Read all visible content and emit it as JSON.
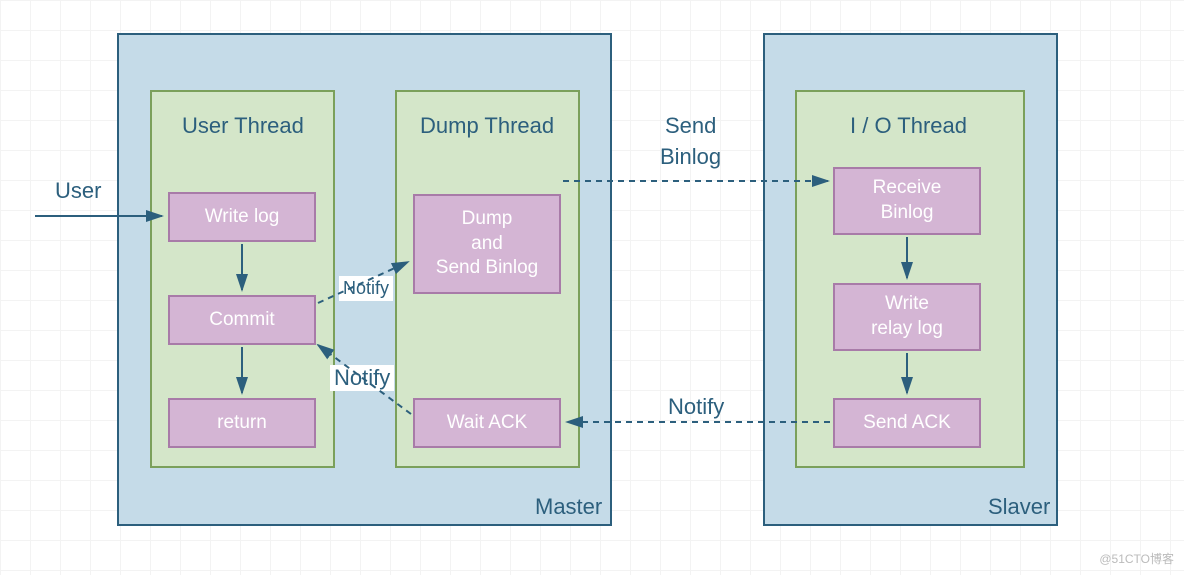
{
  "diagram": {
    "master_label": "Master",
    "slaver_label": "Slaver",
    "user_label": "User",
    "send_binlog_label_1": "Send",
    "send_binlog_label_2": "Binlog",
    "user_thread": {
      "title": "User Thread",
      "write_log": "Write log",
      "commit": "Commit",
      "return": "return"
    },
    "dump_thread": {
      "title": "Dump Thread",
      "dump_send": "Dump\nand\nSend  Binlog",
      "wait_ack": "Wait ACK"
    },
    "io_thread": {
      "title": "I / O Thread",
      "receive": "Receive\nBinlog",
      "write_relay": "Write\nrelay log",
      "send_ack": "Send ACK"
    },
    "notify_labels": {
      "commit_to_dump": "Notify",
      "wait_to_commit": "Notify",
      "sendack_to_wait": "Notify"
    }
  },
  "watermark": "@51CTO博客"
}
